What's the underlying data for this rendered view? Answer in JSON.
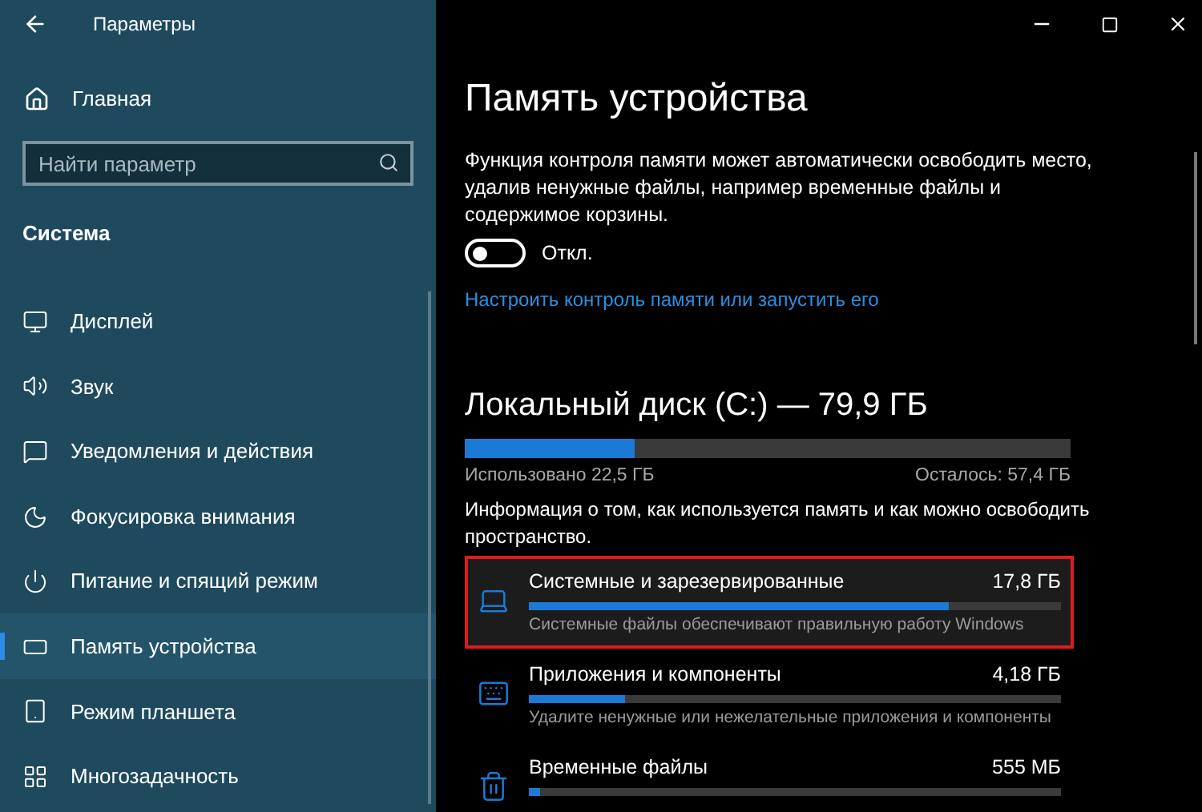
{
  "window": {
    "title": "Параметры"
  },
  "sidebar": {
    "home": "Главная",
    "search": {
      "placeholder": "Найти параметр"
    },
    "section": "Система",
    "items": [
      {
        "label": "Дисплей",
        "selected": false
      },
      {
        "label": "Звук",
        "selected": false
      },
      {
        "label": "Уведомления и действия",
        "selected": false
      },
      {
        "label": "Фокусировка внимания",
        "selected": false
      },
      {
        "label": "Питание и спящий режим",
        "selected": false
      },
      {
        "label": "Память устройства",
        "selected": true
      },
      {
        "label": "Режим планшета",
        "selected": false
      },
      {
        "label": "Многозадачность",
        "selected": false
      }
    ]
  },
  "main": {
    "title": "Память устройства",
    "description": "Функция контроля памяти может автоматически освободить место, удалив ненужные файлы, например временные файлы и содержимое корзины.",
    "toggle": {
      "on": false,
      "label": "Откл."
    },
    "link": "Настроить контроль памяти или запустить его",
    "disk": {
      "title": "Локальный диск (C:) — 79,9 ГБ",
      "level": 0.28,
      "used": "Использовано 22,5 ГБ",
      "free": "Осталось: 57,4 ГБ"
    },
    "info": "Информация о том, как используется память и как можно освободить пространство.",
    "categories": [
      {
        "name": "Системные и зарезервированные",
        "size": "17,8 ГБ",
        "level": 0.79,
        "hint": "Системные файлы обеспечивают правильную работу Windows",
        "highlighted": true
      },
      {
        "name": "Приложения и компоненты",
        "size": "4,18 ГБ",
        "level": 0.18,
        "hint": "Удалите ненужные или нежелательные приложения и компоненты",
        "highlighted": false
      },
      {
        "name": "Временные файлы",
        "size": "555 МБ",
        "level": 0.02,
        "highlighted": false
      }
    ]
  }
}
